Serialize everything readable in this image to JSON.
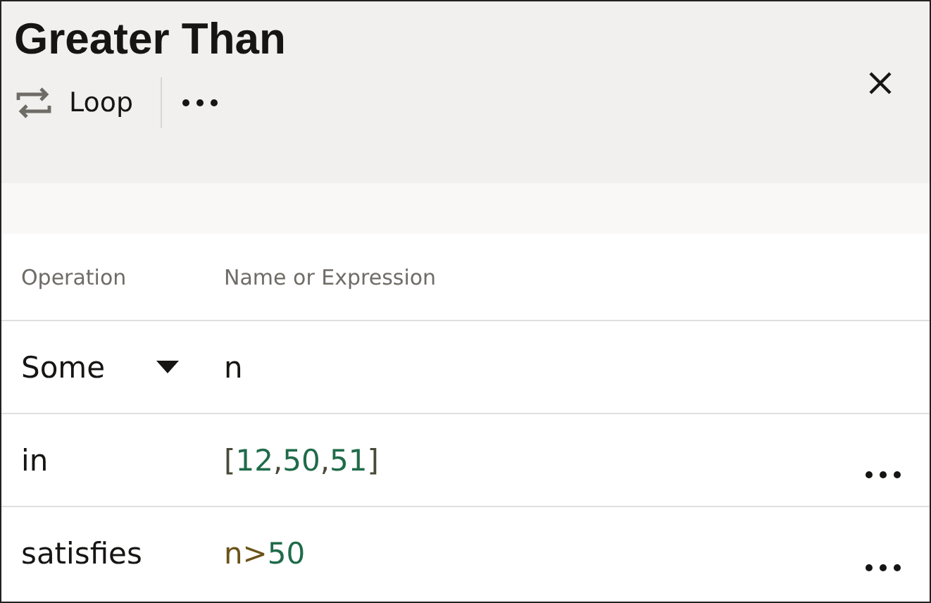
{
  "title": "Greater Than",
  "toolbar": {
    "loop_label": "Loop"
  },
  "table": {
    "columns": [
      "Operation",
      "Name or Expression"
    ],
    "rows": [
      {
        "operation": "Some",
        "kind": "dropdown",
        "menu": false,
        "expression": [
          {
            "kind": "plain",
            "text": "n"
          }
        ]
      },
      {
        "operation": "in",
        "kind": "text",
        "menu": true,
        "expression": [
          {
            "kind": "punct",
            "text": "["
          },
          {
            "kind": "number",
            "text": "12"
          },
          {
            "kind": "punct",
            "text": ","
          },
          {
            "kind": "number",
            "text": "50"
          },
          {
            "kind": "punct",
            "text": ","
          },
          {
            "kind": "number",
            "text": "51"
          },
          {
            "kind": "punct",
            "text": "]"
          }
        ]
      },
      {
        "operation": "satisfies",
        "kind": "text",
        "menu": true,
        "expression": [
          {
            "kind": "name",
            "text": "n>"
          },
          {
            "kind": "number",
            "text": "50"
          }
        ]
      }
    ]
  }
}
